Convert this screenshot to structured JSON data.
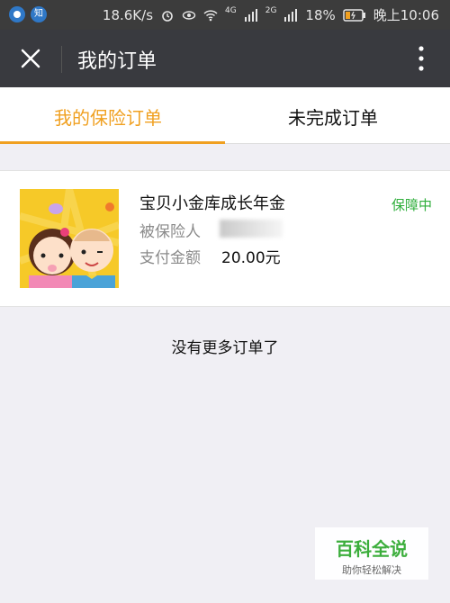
{
  "statusbar": {
    "left_icons": [
      "app-icon",
      "zhi-icon"
    ],
    "zhi_text": "知",
    "net_speed": "18.6K/s",
    "signal1_label": "4G",
    "signal2_label": "2G",
    "battery": "18%",
    "time": "晚上10:06"
  },
  "titlebar": {
    "title": "我的订单",
    "close_icon": "close-icon",
    "more_icon": "more-icon"
  },
  "tabs": [
    {
      "label": "我的保险订单",
      "active": true
    },
    {
      "label": "未完成订单",
      "active": false
    }
  ],
  "order": {
    "name": "宝贝小金库成长年金",
    "status": "保障中",
    "insured_label": "被保险人",
    "amount_label": "支付金额",
    "amount": "20.00元"
  },
  "footer_text": "没有更多订单了",
  "watermark": {
    "title": "百科全说",
    "subtitle": "助你轻松解决"
  },
  "colors": {
    "accent": "#f0a020",
    "status_green": "#2fae3b",
    "titlebar_bg": "#393a3f"
  }
}
